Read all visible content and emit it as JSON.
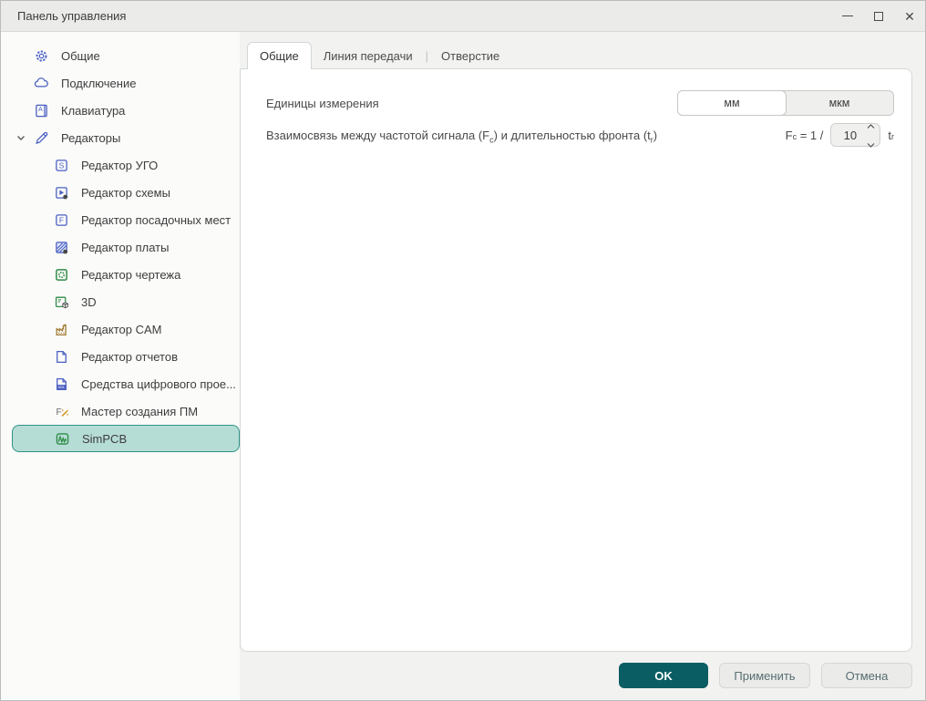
{
  "window": {
    "title": "Панель управления"
  },
  "sidebar": {
    "items": [
      {
        "name": "general",
        "label": "Общие",
        "icon": "gear-icon",
        "level": 0
      },
      {
        "name": "connection",
        "label": "Подключение",
        "icon": "cloud-icon",
        "level": 0
      },
      {
        "name": "keyboard",
        "label": "Клавиатура",
        "icon": "keyboard-icon",
        "level": 0
      },
      {
        "name": "editors",
        "label": "Редакторы",
        "icon": "pencil-icon",
        "level": 0,
        "expanded": true
      },
      {
        "name": "symbol-editor",
        "label": "Редактор УГО",
        "icon": "symbol-editor-icon",
        "level": 1
      },
      {
        "name": "schematic-editor",
        "label": "Редактор схемы",
        "icon": "schematic-editor-icon",
        "level": 1
      },
      {
        "name": "footprint-editor",
        "label": "Редактор посадочных мест",
        "icon": "footprint-editor-icon",
        "level": 1
      },
      {
        "name": "board-editor",
        "label": "Редактор платы",
        "icon": "board-editor-icon",
        "level": 1
      },
      {
        "name": "drawing-editor",
        "label": "Редактор чертежа",
        "icon": "drawing-editor-icon",
        "level": 1
      },
      {
        "name": "3d",
        "label": "3D",
        "icon": "3d-editor-icon",
        "level": 1
      },
      {
        "name": "cam-editor",
        "label": "Редактор CAM",
        "icon": "cam-editor-icon",
        "level": 1
      },
      {
        "name": "report-editor",
        "label": "Редактор отчетов",
        "icon": "report-editor-icon",
        "level": 1
      },
      {
        "name": "digital-design-tools",
        "label": "Средства цифрового прое...",
        "icon": "hdl-tools-icon",
        "level": 1
      },
      {
        "name": "footprint-wizard",
        "label": "Мастер создания ПМ",
        "icon": "footprint-wizard-icon",
        "level": 1
      },
      {
        "name": "simpcb",
        "label": "SimPCB",
        "icon": "simpcb-icon",
        "level": 1,
        "selected": true
      }
    ]
  },
  "tabs": {
    "items": [
      {
        "name": "general",
        "label": "Общие",
        "active": true
      },
      {
        "name": "transmission-line",
        "label": "Линия передачи",
        "active": false
      },
      {
        "name": "via",
        "label": "Отверстие",
        "active": false
      }
    ]
  },
  "content": {
    "units": {
      "label": "Единицы измерения",
      "options": [
        {
          "name": "mm",
          "label": "мм",
          "selected": true
        },
        {
          "name": "um",
          "label": "мкм",
          "selected": false
        }
      ]
    },
    "freq": {
      "label_pre": "Взаимосвязь между частотой сигнала (F",
      "label_sub1": "c",
      "label_mid": ") и длительностью фронта (t",
      "label_sub2": "r",
      "label_post": ")",
      "formula_f": "F",
      "formula_f_sub": "c",
      "formula_eq": " = 1 /",
      "value": "10",
      "unit_t": "t",
      "unit_t_sub": "r"
    }
  },
  "footer": {
    "ok": "OK",
    "apply": "Применить",
    "cancel": "Отмена"
  },
  "colors": {
    "accent_teal": "#0a5d63",
    "selection_bg": "#b6dcd6",
    "selection_border": "#2f9387",
    "icon_blue": "#4a5fc1",
    "icon_green": "#2e8b45",
    "titlebar_bg": "#ebebe9",
    "panel_border": "#d3d8d7"
  }
}
